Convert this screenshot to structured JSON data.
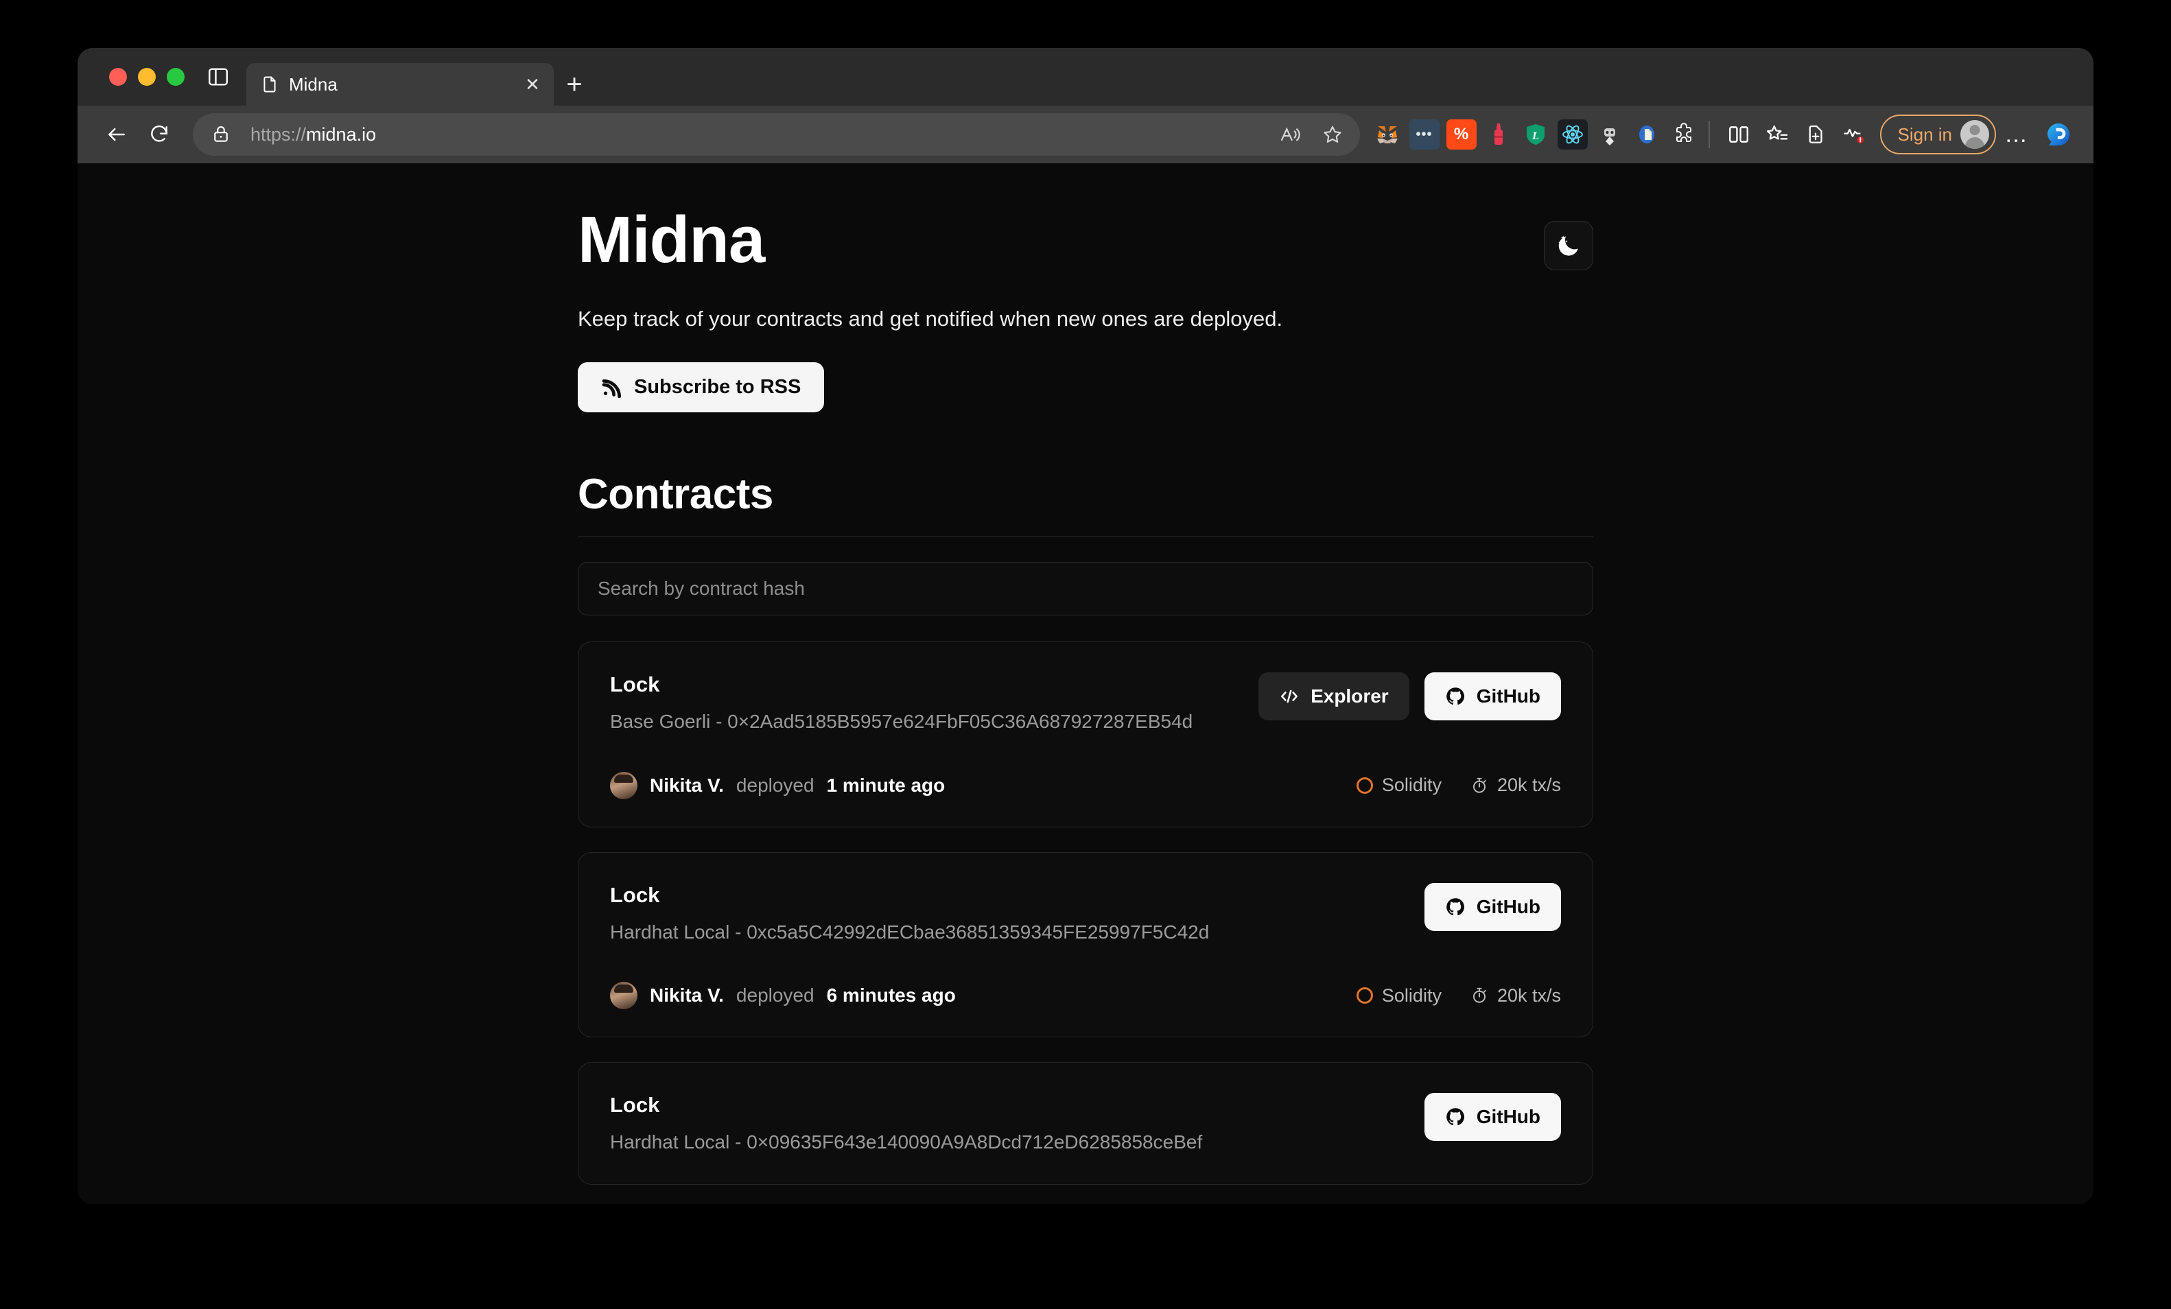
{
  "browser": {
    "tab": {
      "title": "Midna",
      "favicon_icon": "document-icon",
      "close_icon": "close-icon"
    },
    "new_tab_label": "+",
    "tab_list_icon": "tab-list-icon",
    "back_icon": "back-arrow-icon",
    "reload_icon": "reload-icon",
    "url": {
      "scheme": "https://",
      "host": "midna.io",
      "lock_icon": "lock-icon"
    },
    "read_aloud_icon": "read-aloud-icon",
    "favorite_icon": "star-outline-icon",
    "extensions": [
      {
        "name": "metamask-extension-icon",
        "glyph": "🦊"
      },
      {
        "name": "dots-extension-icon",
        "glyph": "•••"
      },
      {
        "name": "percent-extension-icon",
        "glyph": "%"
      },
      {
        "name": "bottle-extension-icon",
        "glyph": ""
      },
      {
        "name": "shield-extension-icon",
        "glyph": "L"
      },
      {
        "name": "react-devtools-extension-icon",
        "glyph": ""
      },
      {
        "name": "robot-extension-icon",
        "glyph": ""
      },
      {
        "name": "document-extension-icon",
        "glyph": ""
      },
      {
        "name": "puzzle-extension-icon",
        "glyph": ""
      }
    ],
    "split_screen_icon": "split-screen-icon",
    "collections_star_icon": "favorites-list-icon",
    "add_collection_icon": "add-collection-icon",
    "browser_essentials_icon": "browser-essentials-icon",
    "sign_in_label": "Sign in",
    "avatar_icon": "profile-avatar-icon",
    "settings_more_label": "…",
    "copilot_icon": "copilot-icon"
  },
  "page": {
    "brand": "Midna",
    "theme_toggle_icon": "moon-stars-icon",
    "tagline": "Keep track of your contracts and get notified when new ones are deployed.",
    "rss_button": {
      "label": "Subscribe to RSS",
      "icon": "rss-icon"
    },
    "section_title": "Contracts",
    "search": {
      "placeholder": "Search by contract hash",
      "value": ""
    },
    "contracts": [
      {
        "name": "Lock",
        "subtitle": "Base Goerli - 0×2Aad5185B5957e624FbF05C36A687927287EB54d",
        "actions": [
          {
            "label": "Explorer",
            "icon": "code-brackets-icon",
            "style": "dark"
          },
          {
            "label": "GitHub",
            "icon": "github-icon",
            "style": "light"
          }
        ],
        "deployer": {
          "name": "Nikita V.",
          "verb": "deployed",
          "time": "1 minute ago",
          "avatar": "user-avatar"
        },
        "meta": [
          {
            "label": "Solidity",
            "icon": "solidity-ring-icon"
          },
          {
            "label": "20k tx/s",
            "icon": "stopwatch-icon"
          }
        ]
      },
      {
        "name": "Lock",
        "subtitle": "Hardhat Local - 0xc5a5C42992dECbae36851359345FE25997F5C42d",
        "actions": [
          {
            "label": "GitHub",
            "icon": "github-icon",
            "style": "light"
          }
        ],
        "deployer": {
          "name": "Nikita V.",
          "verb": "deployed",
          "time": "6 minutes ago",
          "avatar": "user-avatar"
        },
        "meta": [
          {
            "label": "Solidity",
            "icon": "solidity-ring-icon"
          },
          {
            "label": "20k tx/s",
            "icon": "stopwatch-icon"
          }
        ]
      },
      {
        "name": "Lock",
        "subtitle": "Hardhat Local - 0×09635F643e140090A9A8Dcd712eD6285858ceBef",
        "actions": [
          {
            "label": "GitHub",
            "icon": "github-icon",
            "style": "light"
          }
        ],
        "deployer": null,
        "meta": []
      }
    ]
  },
  "colors": {
    "page_bg": "#0a0a0a",
    "card_bg": "#0d0d0d",
    "card_border": "#262626",
    "accent_orange": "#e0752a",
    "signin_orange": "#f0a868",
    "chrome_bg": "#3c3c3c",
    "tabstrip_bg": "#2b2b2b"
  }
}
